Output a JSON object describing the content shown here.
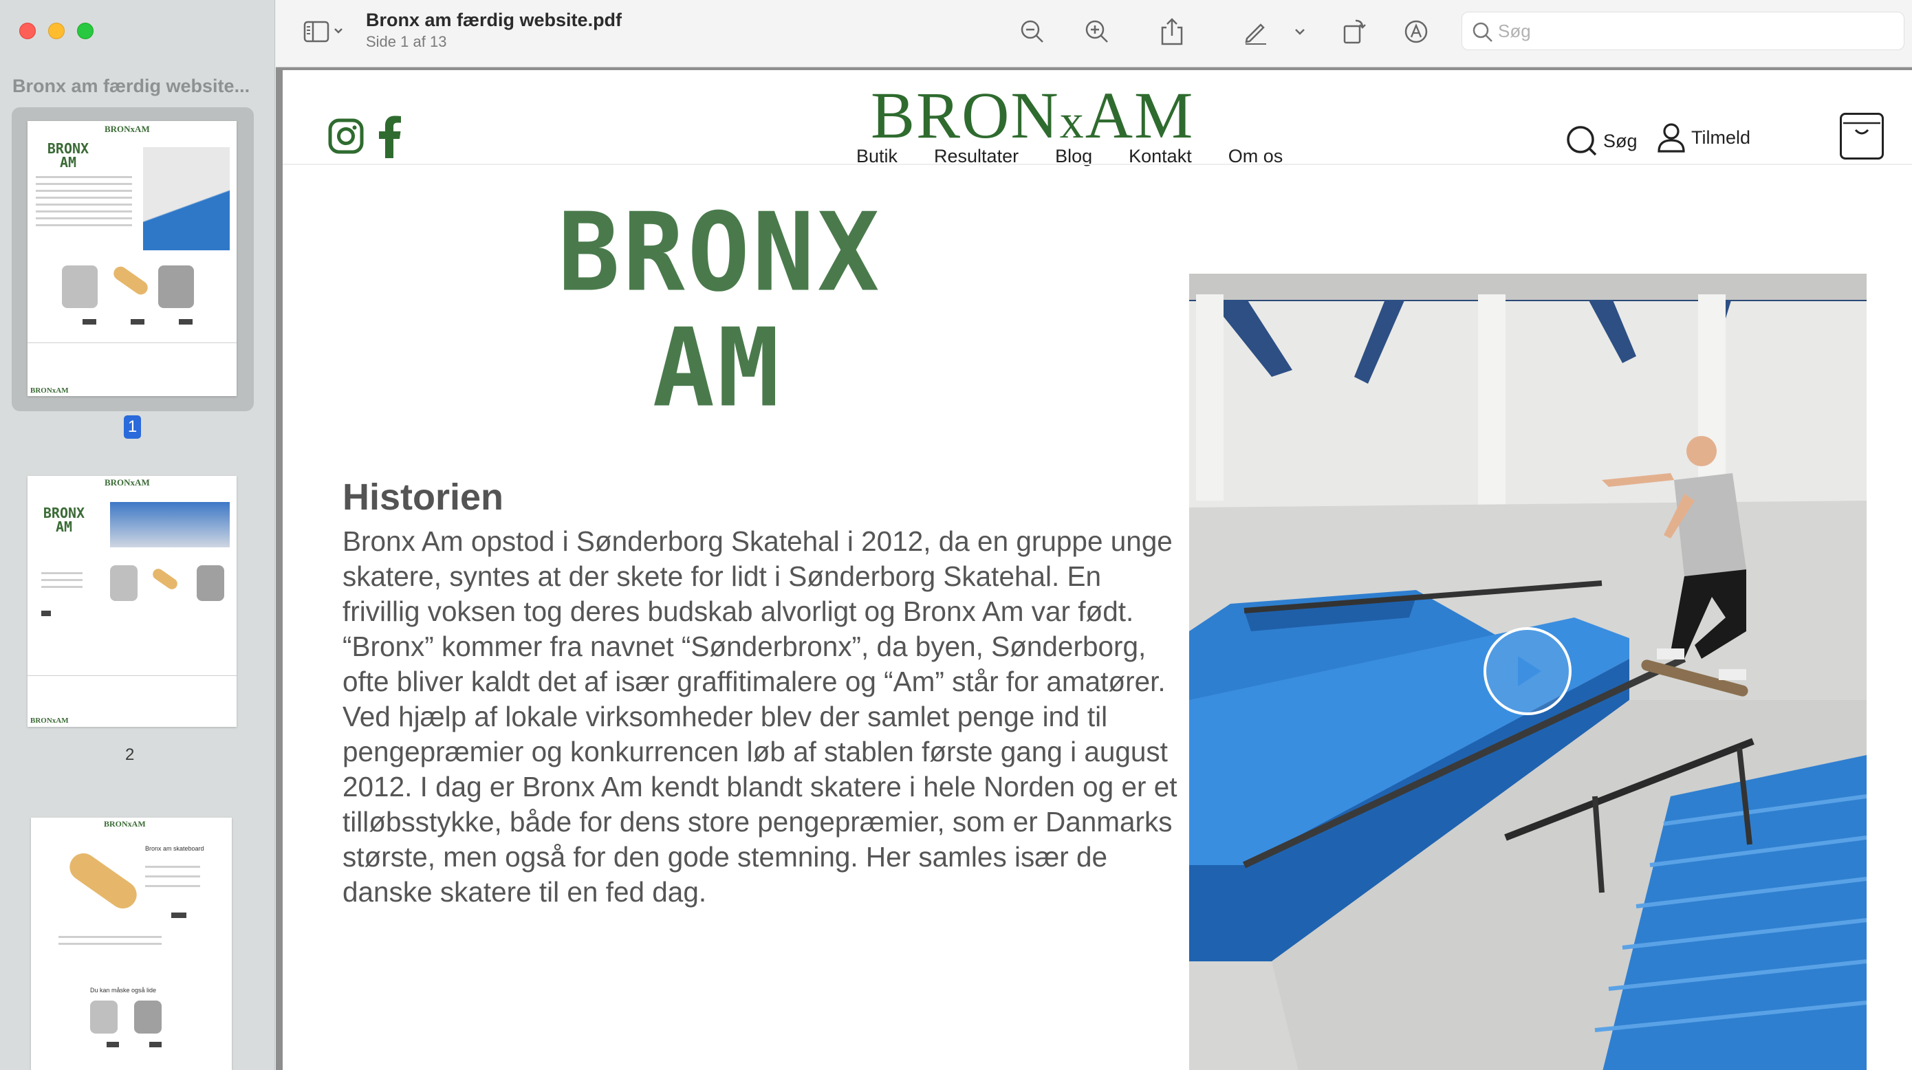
{
  "window": {
    "sidebar_title": "Bronx am færdig website...",
    "doc_title": "Bronx am færdig website.pdf",
    "doc_subtitle": "Side 1 af 13",
    "search_placeholder": "Søg"
  },
  "thumbnails": [
    {
      "page": "1",
      "selected": true
    },
    {
      "page": "2",
      "selected": false
    },
    {
      "page": "3",
      "selected": false
    }
  ],
  "thumb_text": {
    "t1_logo": "BRONxAM",
    "t1_bronx": "BRONX",
    "t1_am": "AM",
    "t1_foot_logo": "BRONxAM",
    "t2_logo": "BRONxAM",
    "t2_bronx": "BRONX",
    "t2_am": "AM",
    "t2_foot_logo": "BRONxAM",
    "t3_logo": "BRONxAM",
    "t3_product_title": "Bronx am skateboard",
    "t3_also_like": "Du kan måske også lide"
  },
  "site": {
    "brand_main": "BRON",
    "brand_x": "x",
    "brand_end": "AM",
    "nav": [
      "Butik",
      "Resultater",
      "Blog",
      "Kontakt",
      "Om os"
    ],
    "search_label": "Søg",
    "signup_label": "Tilmeld",
    "logo_line1": "BRONX",
    "logo_line2": "AM",
    "history_title": "Historien",
    "history_body": "Bronx Am opstod i Sønderborg Skatehal i 2012, da en gruppe unge skatere, syntes at der skete for lidt i Sønderborg Skatehal. En frivillig voksen tog deres budskab alvorligt og Bronx Am var født. “Bronx” kommer fra navnet “Sønderbronx”, da byen, Sønderborg, ofte bliver kaldt det af især graffitimalere og “Am” står for amatører. Ved hjælp af lokale virksomheder blev der samlet penge ind til pengepræmier og konkurrencen løb af stablen første gang i august 2012. I dag er Bronx Am kendt blandt skatere i hele Norden og er et tilløbsstykke, både for dens store pengepræmier, som er Danmarks største, men også for den gode stemning. Her samles især de danske skatere til en fed dag."
  },
  "colors": {
    "brand_green": "#2f6b2f",
    "selection_blue": "#2a6adb",
    "ramp_blue": "#2f7fd0"
  },
  "icons": [
    "sidebar-toggle-icon",
    "zoom-out-icon",
    "zoom-in-icon",
    "share-icon",
    "markup-pen-icon",
    "rotate-icon",
    "annotate-icon",
    "search-icon",
    "instagram-icon",
    "facebook-icon",
    "cart-icon",
    "user-icon",
    "play-icon"
  ]
}
